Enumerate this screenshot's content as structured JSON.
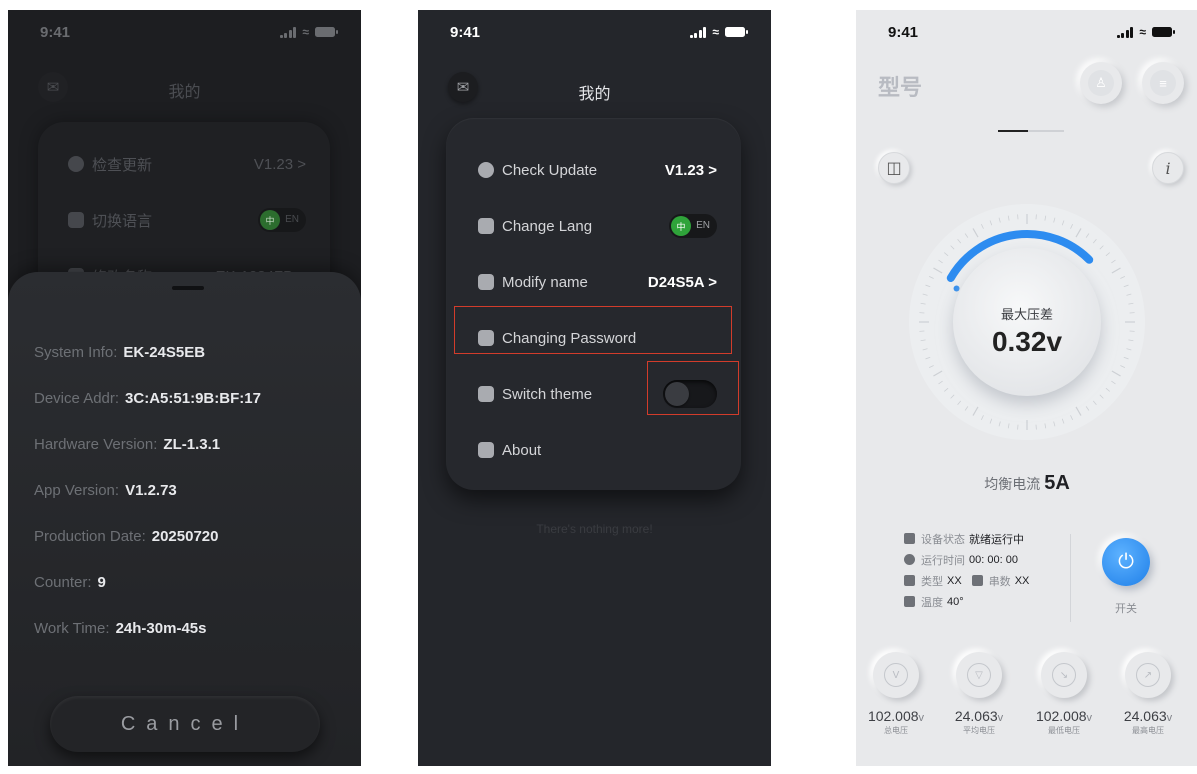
{
  "phone_dark_sheet": {
    "status": {
      "time": "9:41"
    },
    "nav": {
      "title": "我的",
      "icon": "mail-icon"
    },
    "settings": [
      {
        "label": "检查更新",
        "value": "V1.23 >"
      },
      {
        "label": "切换语言",
        "toggle_on": "中",
        "toggle_off": "EN"
      },
      {
        "label": "修改名称",
        "value": "EK-1284FB >"
      }
    ],
    "sheet": {
      "items": [
        {
          "label": "System Info:",
          "value": "EK-24S5EB"
        },
        {
          "label": "Device Addr:",
          "value": "3C:A5:51:9B:BF:17"
        },
        {
          "label": "Hardware Version:",
          "value": "ZL-1.3.1"
        },
        {
          "label": "App Version:",
          "value": "V1.2.73"
        },
        {
          "label": "Production Date:",
          "value": "20250720"
        },
        {
          "label": "Counter:",
          "value": "9"
        },
        {
          "label": "Work Time:",
          "value": "24h-30m-45s"
        }
      ],
      "cancel_label": "Cancel"
    }
  },
  "phone_dark_settings": {
    "status": {
      "time": "9:41"
    },
    "nav": {
      "title": "我的",
      "icon": "mail-icon"
    },
    "rows": [
      {
        "label": "Check Update",
        "value": "V1.23 >"
      },
      {
        "label": "Change Lang",
        "toggle_on": "中",
        "toggle_off": "EN"
      },
      {
        "label": "Modify name",
        "value": "D24S5A >"
      },
      {
        "label": "Changing Password"
      },
      {
        "label": "Switch theme"
      },
      {
        "label": "About"
      }
    ],
    "footer": "There's nothing more!",
    "highlight_color": "#d23c2b"
  },
  "phone_light_gauge": {
    "status": {
      "time": "9:41"
    },
    "header": {
      "model": "型号"
    },
    "gauge": {
      "label": "最大压差",
      "value": "0.32v",
      "fraction": 0.35,
      "accent": "#2d8cf0"
    },
    "current": {
      "label": "均衡电流",
      "value": "5A"
    },
    "stats": [
      {
        "label": "设备状态",
        "value": "就绪运行中"
      },
      {
        "label": "运行时间",
        "value": "00: 00: 00"
      },
      {
        "label": "类型",
        "value": "XX",
        "label2": "串数",
        "value2": "XX"
      },
      {
        "label": "温度",
        "value": "40°"
      }
    ],
    "power_label": "开关",
    "meters": [
      {
        "value": "102.008",
        "unit": "v",
        "label": "总电压"
      },
      {
        "value": "24.063",
        "unit": "v",
        "label": "平均电压"
      },
      {
        "value": "102.008",
        "unit": "v",
        "label": "最低电压"
      },
      {
        "value": "24.063",
        "unit": "v",
        "label": "最高电压"
      }
    ]
  }
}
